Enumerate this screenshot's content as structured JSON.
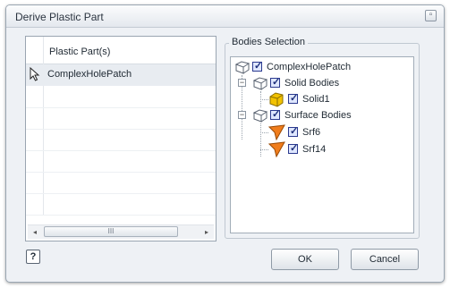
{
  "window": {
    "title": "Derive Plastic Part",
    "close_glyph": "▫"
  },
  "parts_list": {
    "column_header": "Plastic Part(s)",
    "rows": [
      {
        "label": "ComplexHolePatch",
        "icon": "pointer-icon"
      }
    ],
    "scroll_left": "◂",
    "scroll_right": "▸",
    "scroll_thumb_grip": "III"
  },
  "bodies_selection": {
    "label": "Bodies Selection",
    "tree": {
      "root": "ComplexHolePatch",
      "solid_bodies": "Solid Bodies",
      "solid1": "Solid1",
      "surface_bodies": "Surface Bodies",
      "srf6": "Srf6",
      "srf14": "Srf14"
    },
    "colors": {
      "solid_icon": "#f2c200",
      "surface_icon": "#f07d1c",
      "checkbox": "#2b3a8f"
    }
  },
  "buttons": {
    "help": "?",
    "ok": "OK",
    "cancel": "Cancel"
  }
}
